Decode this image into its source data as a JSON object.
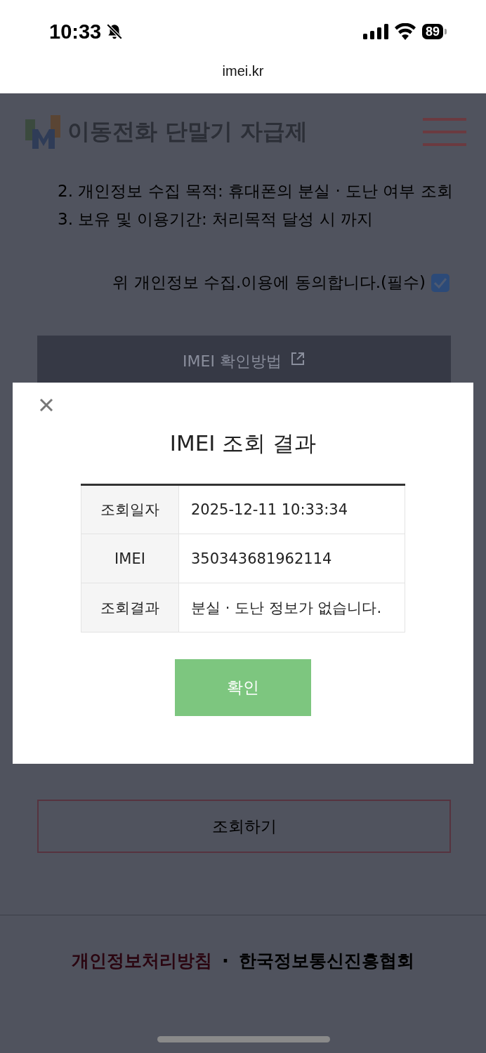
{
  "status_bar": {
    "time": "10:33",
    "battery": "89"
  },
  "address_bar": {
    "url": "imei.kr"
  },
  "header": {
    "title": "이동전화 단말기 자급제"
  },
  "notice_lines": [
    "2. 개인정보 수집 목적: 휴대폰의 분실 · 도난 여부 조회",
    "3. 보유 및 이용기간: 처리목적 달성 시 까지"
  ],
  "consent": {
    "label": "위 개인정보 수집.이용에 동의합니다.(필수)",
    "checked": true
  },
  "guide_button": "IMEI 확인방법",
  "dialog": {
    "title": "IMEI 조회 결과",
    "rows": [
      {
        "label": "조회일자",
        "value": "2025-12-11 10:33:34"
      },
      {
        "label": "IMEI",
        "value": "350343681962114"
      },
      {
        "label": "조회결과",
        "value": "분실 · 도난 정보가 없습니다."
      }
    ],
    "confirm_button": "확인"
  },
  "search_button": "조회하기",
  "footer_links": [
    {
      "label": "개인정보처리방침",
      "kind": "highlight"
    },
    {
      "label": "한국정보통신진흥협회",
      "kind": "plain"
    }
  ],
  "footer_separator": "·"
}
